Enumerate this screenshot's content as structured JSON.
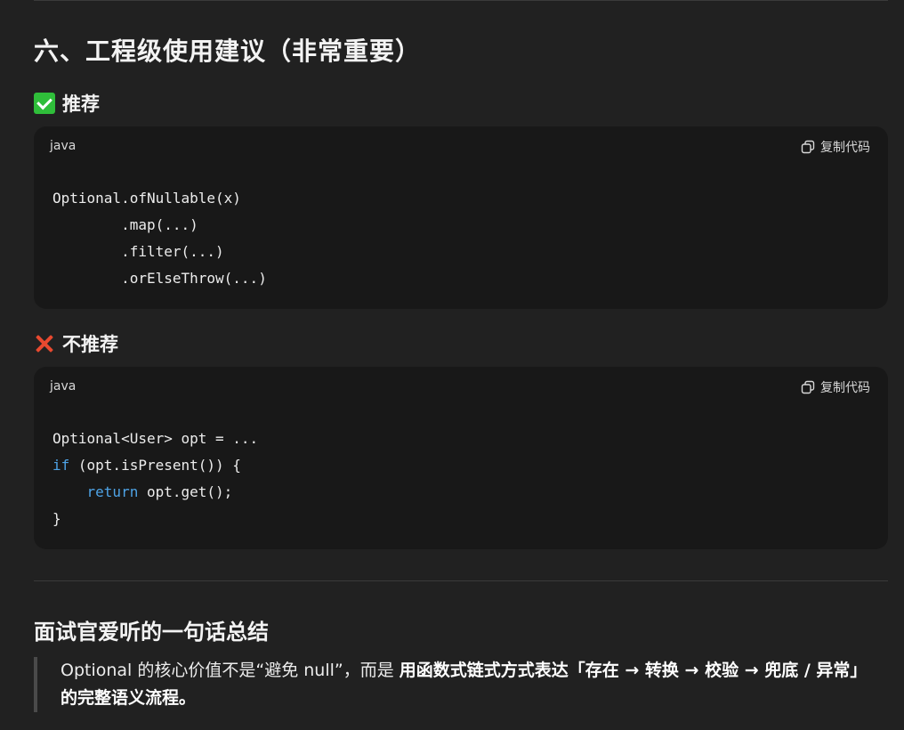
{
  "section_title": "六、工程级使用建议（非常重要）",
  "recommended": {
    "heading": "推荐",
    "code": {
      "language": "java",
      "copy_label": "复制代码",
      "lines": [
        "Optional.ofNullable(x)",
        "        .map(...)",
        "        .filter(...)",
        "        .orElseThrow(...)"
      ]
    }
  },
  "not_recommended": {
    "heading": "不推荐",
    "code": {
      "language": "java",
      "copy_label": "复制代码",
      "line1": "Optional<User> opt = ...",
      "line2_kw": "if",
      "line2_rest": " (opt.isPresent()) {",
      "line3_indent": "    ",
      "line3_kw": "return",
      "line3_rest": " opt.get();",
      "line4": "}"
    }
  },
  "summary": {
    "heading": "面试官爱听的一句话总结",
    "quote_plain": "Optional 的核心价值不是“避免 null”，而是 ",
    "quote_bold": "用函数式链式方式表达「存在 → 转换 → 校验 → 兜底 / 异常」的完整语义流程。"
  },
  "colors": {
    "background": "#212121",
    "code_background": "#181818",
    "keyword": "#4ea3e6",
    "check": "#2fbe3a",
    "cross": "#e8492f"
  },
  "icons": [
    "check-mark-icon",
    "cross-mark-icon",
    "copy-icon"
  ]
}
